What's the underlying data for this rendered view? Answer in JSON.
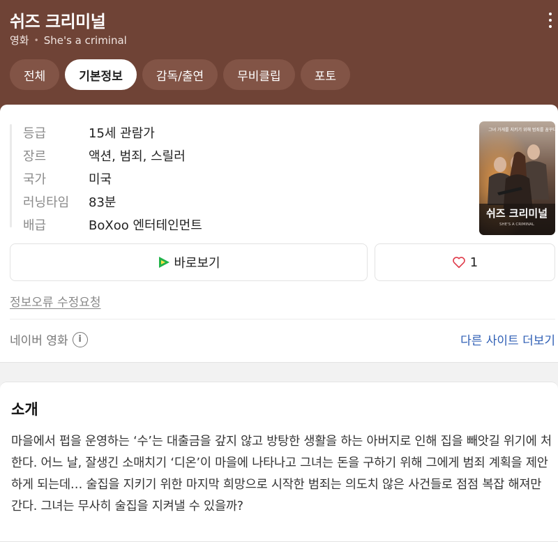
{
  "header": {
    "title": "쉬즈 크리미널",
    "category": "영화",
    "english_title": "She's a criminal",
    "bg_color": "#6f4336"
  },
  "tabs": [
    {
      "label": "전체",
      "active": false
    },
    {
      "label": "기본정보",
      "active": true
    },
    {
      "label": "감독/출연",
      "active": false
    },
    {
      "label": "무비클립",
      "active": false
    },
    {
      "label": "포토",
      "active": false
    }
  ],
  "info": [
    {
      "key": "등급",
      "value": "15세 관람가"
    },
    {
      "key": "장르",
      "value": "액션, 범죄, 스릴러"
    },
    {
      "key": "국가",
      "value": "미국"
    },
    {
      "key": "러닝타임",
      "value": "83분"
    },
    {
      "key": "배급",
      "value": "BoXoo 엔터테인먼트"
    }
  ],
  "poster": {
    "top_text": "그녀 가게를 지키기 위해 범죄를 꿈꾸다",
    "title_text": "쉬즈 크리미널",
    "sub_text": "SHE'S A CRIMINAL"
  },
  "actions": {
    "watch_label": "바로보기",
    "like_count": "1"
  },
  "report_link": "정보오류 수정요청",
  "source": {
    "label": "네이버 영화",
    "more_label": "다른 사이트 더보기"
  },
  "synopsis": {
    "title": "소개",
    "text": "마을에서 펍을 운영하는 ‘수’는 대출금을 갚지 않고 방탕한 생활을 하는 아버지로 인해 집을 빼앗길 위기에 처한다. 어느 날, 잘생긴 소매치기 ‘디온’이 마을에 나타나고 그녀는 돈을 구하기 위해 그에게 범죄 계획을 제안하게 되는데… 술집을 지키기 위한 마지막 희망으로 시작한 범죄는 의도치 않은 사건들로 점점 복잡 해져만 간다. 그녀는 무사히 술집을 지켜낼 수 있을까?"
  }
}
